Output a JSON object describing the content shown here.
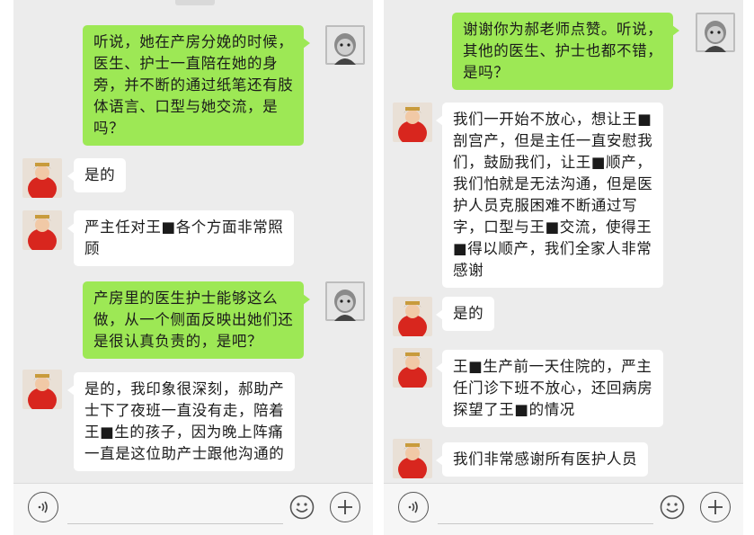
{
  "left_panel": {
    "messages": [
      {
        "side": "right",
        "text": "听说，她在产房分娩的时候，\n医生、护士一直陪在她的身\n旁，并不断的通过纸笔还有肢\n体语言、口型与她交流，是\n吗？"
      },
      {
        "side": "left",
        "text": "是的"
      },
      {
        "side": "left",
        "text": "严主任对王■各个方面非常照\n顾"
      },
      {
        "side": "right",
        "text": "产房里的医生护士能够这么\n做，从一个侧面反映出她们还\n是很认真负责的，是吧？"
      },
      {
        "side": "left",
        "text": "是的，我印象很深刻，郝助产\n士下了夜班一直没有走，陪着\n王■生的孩子，因为晚上阵痛\n一直是这位助产士跟他沟通的"
      }
    ]
  },
  "right_panel": {
    "messages": [
      {
        "side": "right",
        "text": "谢谢你为郝老师点赞。听说，\n其他的医生、护士也都不错，\n是吗？"
      },
      {
        "side": "left",
        "text": "我们一开始不放心，想让王■\n剖宫产，但是主任一直安慰我\n们，鼓励我们，让王■顺产，\n我们怕就是无法沟通，但是医\n护人员克服困难不断通过写\n字，口型与王■交流，使得王\n■得以顺产，我们全家人非常\n感谢"
      },
      {
        "side": "left",
        "text": "是的"
      },
      {
        "side": "left",
        "text": "王■生产前一天住院的，严主\n任门诊下班不放心，还回病房\n探望了王■的情况"
      },
      {
        "side": "left",
        "text": "我们非常感谢所有医护人员"
      }
    ]
  },
  "input_bar": {
    "voice_icon": "voice-icon",
    "emoji_icon": "emoji-icon",
    "plus_icon": "plus-icon"
  },
  "colors": {
    "sent_bubble": "#9de855",
    "received_bubble": "#ffffff",
    "background": "#ececec"
  }
}
